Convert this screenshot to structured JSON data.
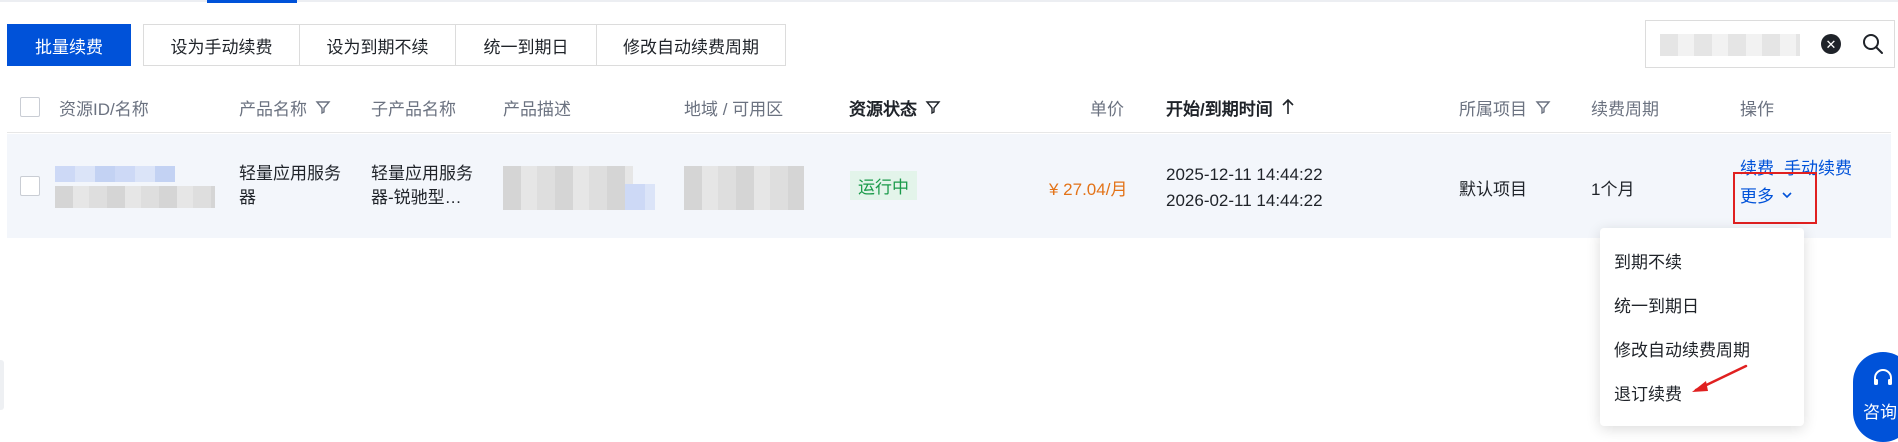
{
  "toolbar": {
    "primary_label": "批量续费",
    "group_buttons": [
      {
        "label": "设为手动续费"
      },
      {
        "label": "设为到期不续"
      },
      {
        "label": "统一到期日"
      },
      {
        "label": "修改自动续费周期"
      }
    ]
  },
  "search": {
    "clear_icon": "close-circle-icon",
    "search_icon": "search-icon"
  },
  "table": {
    "columns": {
      "resource": "资源ID/名称",
      "product": "产品名称",
      "sub_product": "子产品名称",
      "description": "产品描述",
      "region": "地域 / 可用区",
      "status": "资源状态",
      "unit_price": "单价",
      "period_time": "开始/到期时间",
      "project": "所属项目",
      "renew_cycle": "续费周期",
      "actions": "操作"
    },
    "row": {
      "product_line1": "轻量应用服务",
      "product_line2": "器",
      "sub_product_line1": "轻量应用服务",
      "sub_product_line2": "器-锐驰型…",
      "status": "运行中",
      "price": "¥ 27.04/月",
      "start_time": "2025-12-11 14:44:22",
      "end_time": "2026-02-11 14:44:22",
      "project": "默认项目",
      "cycle": "1个月",
      "action_renew": "续费",
      "action_manual": "手动续费",
      "action_more": "更多"
    }
  },
  "dropdown": {
    "items": [
      "到期不续",
      "统一到期日",
      "修改自动续费周期",
      "退订续费"
    ]
  },
  "consult": {
    "label": "咨询"
  },
  "colors": {
    "primary": "#0052d9",
    "success": "#1a9a4a",
    "price": "#e37318",
    "highlight": "#e02020"
  }
}
